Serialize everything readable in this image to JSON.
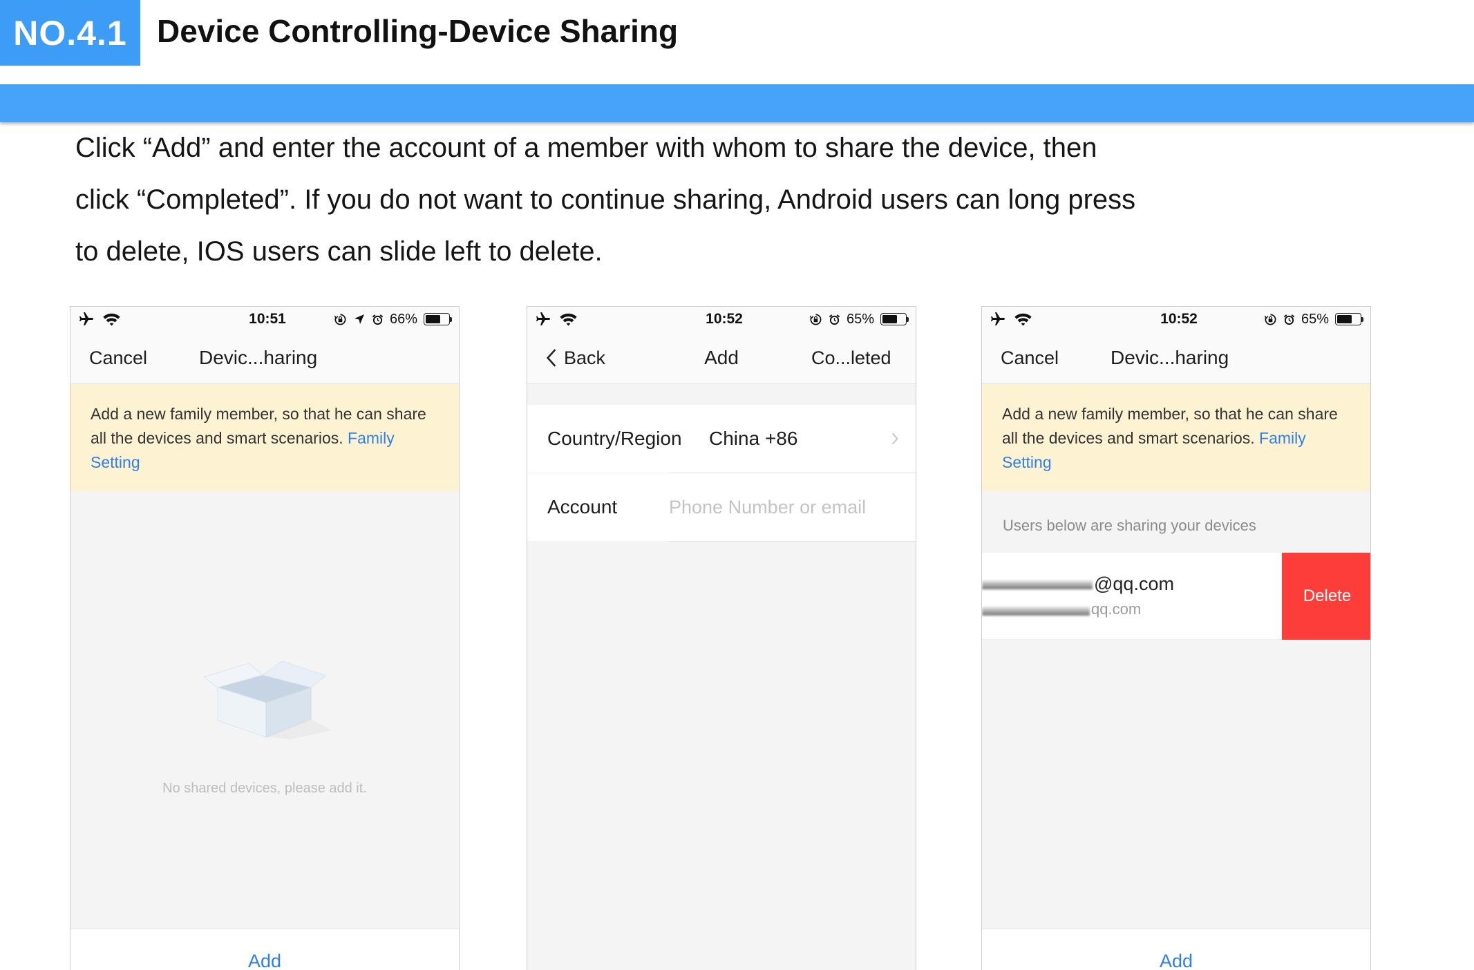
{
  "colors": {
    "accent": "#3d9df6",
    "header_bar": "#47a3f8",
    "banner_background": "#fdf2d1",
    "link": "#2f80e4",
    "delete": "#fc3d39"
  },
  "header": {
    "badge": "NO.4.1",
    "title": "Device Controlling-Device Sharing"
  },
  "instructions": {
    "lines": [
      "Click “Add” and enter the account of a member with whom to share the device, then",
      "click “Completed”. If you do not want to continue sharing, Android users can long press",
      "to delete, IOS users can slide left to delete."
    ]
  },
  "screens": [
    {
      "status_bar": {
        "time": "10:51",
        "battery_text": "66%",
        "battery_level": 0.66,
        "icons": [
          "airplane-icon",
          "wifi-icon",
          "rotation-lock-icon",
          "location-icon",
          "alarm-icon",
          "battery-icon"
        ]
      },
      "nav": {
        "left": "Cancel",
        "title": "Devic...haring"
      },
      "banner": {
        "text": "Add a new family member, so that he can share all the devices and smart scenarios.",
        "link": "Family Setting"
      },
      "empty_state": {
        "icon": "empty-box-icon",
        "text": "No shared devices, please add it."
      },
      "bottom_button": "Add"
    },
    {
      "status_bar": {
        "time": "10:52",
        "battery_text": "65%",
        "battery_level": 0.65,
        "icons": [
          "airplane-icon",
          "wifi-icon",
          "rotation-lock-icon",
          "alarm-icon",
          "battery-icon"
        ]
      },
      "nav": {
        "back": "Back",
        "title": "Add",
        "right": "Co...leted"
      },
      "form": {
        "country_label": "Country/Region",
        "country_value": "China +86",
        "account_label": "Account",
        "account_placeholder": "Phone Number or email"
      }
    },
    {
      "status_bar": {
        "time": "10:52",
        "battery_text": "65%",
        "battery_level": 0.65,
        "icons": [
          "airplane-icon",
          "wifi-icon",
          "rotation-lock-icon",
          "alarm-icon",
          "battery-icon"
        ]
      },
      "nav": {
        "left": "Cancel",
        "title": "Devic...haring"
      },
      "banner": {
        "text": "Add a new family member, so that he can share all the devices and smart scenarios.",
        "link": "Family Setting"
      },
      "section_header": "Users below are sharing your devices",
      "shared_user": {
        "account": "@qq.com",
        "account_secondary": "qq.com"
      },
      "row_action": "Delete",
      "bottom_button": "Add"
    }
  ]
}
